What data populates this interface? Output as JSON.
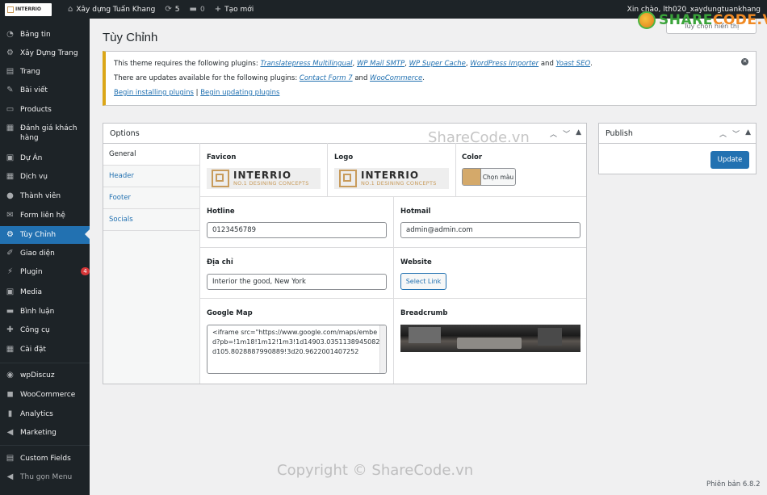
{
  "adminbar": {
    "brand_text": "INTERRIO",
    "site_name": "Xây dựng Tuấn Khang",
    "updates_count": "5",
    "comments_count": "0",
    "new_label": "Tạo mới",
    "greeting": "Xin chào, lth020_xaydungtuankhang"
  },
  "sidebar": {
    "items": [
      {
        "label": "Bảng tin",
        "icon": "dashboard-icon"
      },
      {
        "label": "Xây Dựng Trang",
        "icon": "gear-icon"
      },
      {
        "label": "Trang",
        "icon": "page-icon"
      },
      {
        "label": "Bài viết",
        "icon": "pin-icon"
      },
      {
        "label": "Products",
        "icon": "products-icon"
      },
      {
        "label": "Đánh giá khách hàng",
        "icon": "grid-icon"
      },
      {
        "label": "Dự Án",
        "icon": "folder-icon"
      },
      {
        "label": "Dịch vụ",
        "icon": "grid-icon"
      },
      {
        "label": "Thành viên",
        "icon": "user-icon"
      },
      {
        "label": "Form liên hệ",
        "icon": "mail-icon"
      },
      {
        "label": "Tùy Chỉnh",
        "icon": "gear-icon"
      },
      {
        "label": "Giao diện",
        "icon": "brush-icon"
      },
      {
        "label": "Plugin",
        "icon": "plugin-icon",
        "badge": "4"
      },
      {
        "label": "Media",
        "icon": "media-icon"
      },
      {
        "label": "Bình luận",
        "icon": "comment-icon"
      },
      {
        "label": "Công cụ",
        "icon": "wrench-icon"
      },
      {
        "label": "Cài đặt",
        "icon": "settings-icon"
      },
      {
        "label": "wpDiscuz",
        "icon": "discuz-icon"
      },
      {
        "label": "WooCommerce",
        "icon": "woo-icon"
      },
      {
        "label": "Analytics",
        "icon": "chart-icon"
      },
      {
        "label": "Marketing",
        "icon": "megaphone-icon"
      },
      {
        "label": "Custom Fields",
        "icon": "fields-icon"
      },
      {
        "label": "Thu gọn Menu",
        "icon": "collapse-icon"
      }
    ]
  },
  "page": {
    "title": "Tùy Chỉnh",
    "screen_options": "Tùy chọn hiển thị"
  },
  "notice": {
    "line1_prefix": "This theme requires the following plugins: ",
    "required_plugins": [
      "Translatepress Multilingual",
      "WP Mail SMTP",
      "WP Super Cache",
      "WordPress Importer",
      "Yoast SEO"
    ],
    "line1_and": " and ",
    "line2_prefix": "There are updates available for the following plugins: ",
    "update_plugins": [
      "Contact Form 7",
      "WooCommerce"
    ],
    "begin_installing": "Begin installing plugins",
    "begin_updating": "Begin updating plugins",
    "separator": " | "
  },
  "options": {
    "title": "Options",
    "tabs": [
      "General",
      "Header",
      "Footer",
      "Socials"
    ],
    "favicon_label": "Favicon",
    "logo_label": "Logo",
    "logo_text": "INTERRIO",
    "logo_sub": "NO.1 DESINING CONCEPTS",
    "color_label": "Color",
    "color_button": "Chọn màu",
    "color_value": "#d4a96a",
    "hotline_label": "Hotline",
    "hotline_value": "0123456789",
    "hotmail_label": "Hotmail",
    "hotmail_value": "admin@admin.com",
    "address_label": "Địa chỉ",
    "address_value": "Interior the good, New York",
    "website_label": "Website",
    "select_link": "Select Link",
    "gmap_label": "Google Map",
    "gmap_value": "<iframe src=\"https://www.google.com/maps/embed?pb=!1m18!1m12!1m3!1d14903.0351138945082d105.8028887990889!3d20.9622001407252",
    "breadcrumb_label": "Breadcrumb"
  },
  "publish": {
    "title": "Publish",
    "update_button": "Update"
  },
  "watermarks": {
    "top": "ShareCode.vn",
    "bottom": "Copyright © ShareCode.vn",
    "logo_share": "SHARE",
    "logo_code": "CODE.VN"
  },
  "footer": {
    "version": "Phiên bản 6.8.2"
  },
  "colors": {
    "admin_bg": "#1d2327",
    "accent": "#2271b1",
    "notice_border": "#dba617",
    "badge": "#d63638"
  }
}
